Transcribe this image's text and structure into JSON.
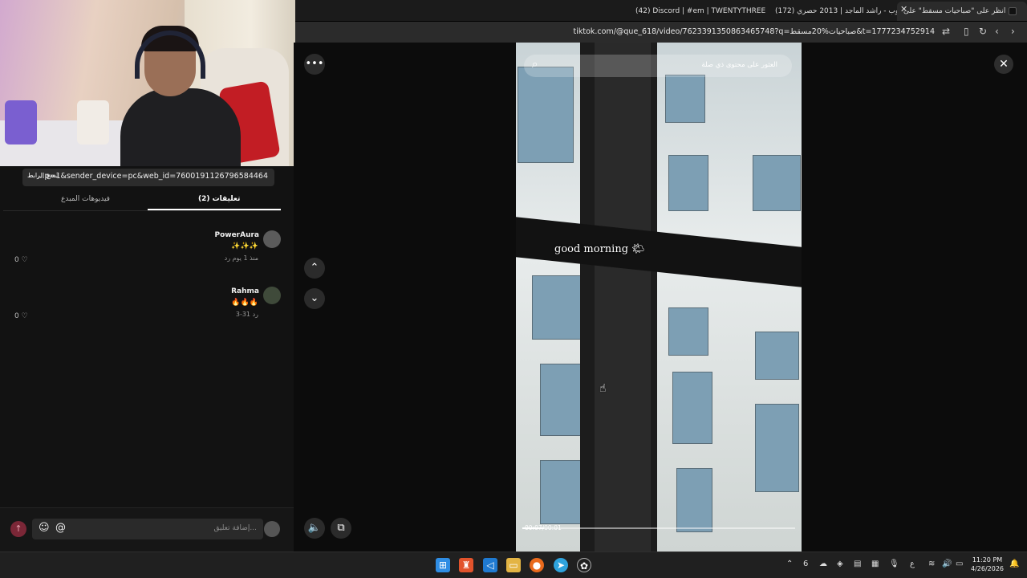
{
  "browser": {
    "tabs": [
      {
        "label": "انظر على \"صباحيات مسقط\" على",
        "active": true
      },
      {
        "label": "(172) غروب - راشد الماجد | 2013 حصري",
        "active": false
      },
      {
        "label": "(42) Discord | #em | TWENTYTHREE",
        "active": false
      }
    ],
    "new_tab_symbol": "+",
    "url": "tiktok.com/@que_618/video/7623391350863465748?q=صباحيات%20مسقط&t=1777234752914"
  },
  "left_panel": {
    "copy_link_label": "نسخ الرابط",
    "share_url": "...p=1&sender_device=pc&web_id=7600191126796584464",
    "tabs": [
      {
        "label": "تعليقات (2)",
        "active": true
      },
      {
        "label": "فيديوهات المبدع",
        "active": false
      }
    ],
    "comments": [
      {
        "user": "PowerAura",
        "text": "✨✨✨",
        "meta": "منذ 1 يوم   رد",
        "likes": "0 ♡"
      },
      {
        "user": "Rahma",
        "text": "🔥🔥🔥",
        "meta": "3-31   رد",
        "likes": "0 ♡"
      }
    ],
    "comment_placeholder": "إضافة تعليق..."
  },
  "video": {
    "search_placeholder": "العثور على محتوى ذي صلة",
    "caption": "good morning 🌤",
    "time": "00:07/00:01",
    "progress": 0.08
  },
  "taskbar": {
    "time": "11:20 PM",
    "date": "4/26/2026",
    "lang": "ع"
  },
  "colors": {
    "accent": "#fe2c55",
    "background": "#121212"
  }
}
